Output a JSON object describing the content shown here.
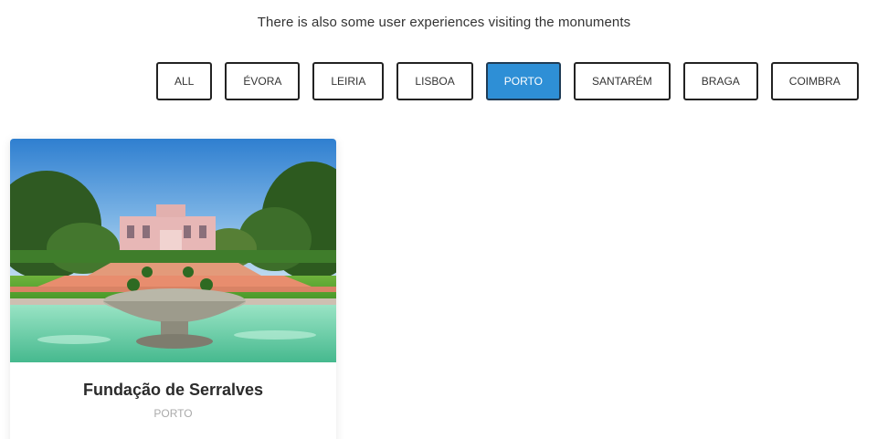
{
  "intro_text": "There is also some user experiences visiting the monuments",
  "filters": [
    {
      "label": "ALL",
      "active": false
    },
    {
      "label": "ÉVORA",
      "active": false
    },
    {
      "label": "LEIRIA",
      "active": false
    },
    {
      "label": "LISBOA",
      "active": false
    },
    {
      "label": "PORTO",
      "active": true
    },
    {
      "label": "SANTARÉM",
      "active": false
    },
    {
      "label": "BRAGA",
      "active": false
    },
    {
      "label": "COIMBRA",
      "active": false
    }
  ],
  "colors": {
    "accent": "#2e8fd6",
    "text": "#333333",
    "muted": "#aaaaaa"
  },
  "cards": [
    {
      "title": "Fundação de Serralves",
      "location": "PORTO",
      "image_icon": "serralves-photo"
    }
  ]
}
